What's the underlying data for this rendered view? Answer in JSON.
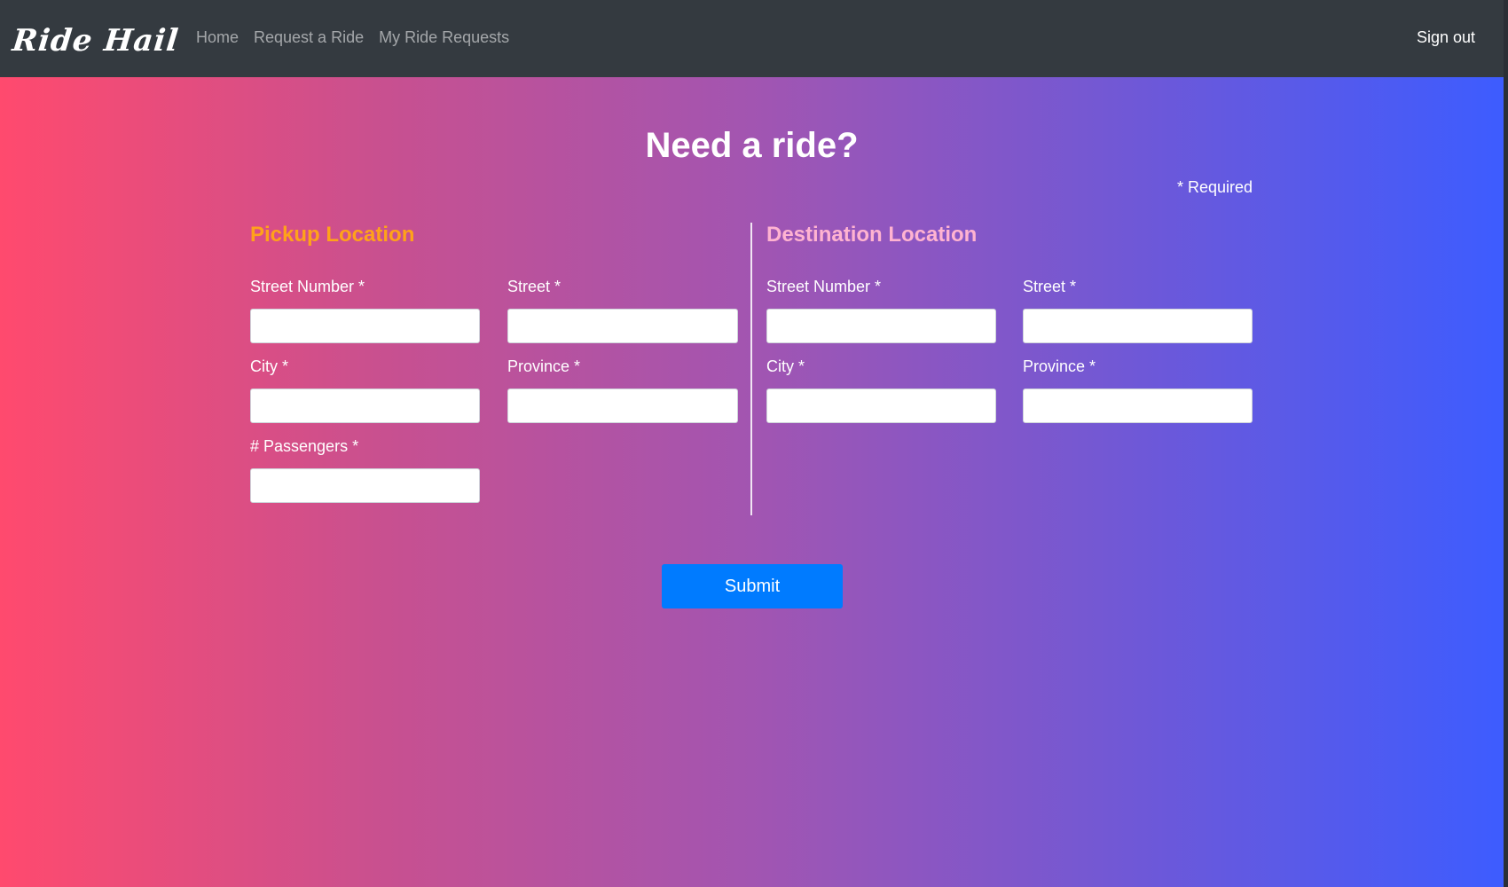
{
  "app": {
    "brand": "Ride Hail"
  },
  "nav": {
    "links": [
      "Home",
      "Request a Ride",
      "My Ride Requests"
    ],
    "signout": "Sign out"
  },
  "page": {
    "title": "Need a ride?",
    "required_note": "* Required"
  },
  "pickup": {
    "title": "Pickup Location",
    "street_number_label": "Street Number *",
    "street_label": "Street *",
    "city_label": "City *",
    "province_label": "Province *",
    "passengers_label": "# Passengers *",
    "street_number_value": "",
    "street_value": "",
    "city_value": "",
    "province_value": "",
    "passengers_value": ""
  },
  "destination": {
    "title": "Destination Location",
    "street_number_label": "Street Number *",
    "street_label": "Street *",
    "city_label": "City *",
    "province_label": "Province *",
    "street_number_value": "",
    "street_value": "",
    "city_value": "",
    "province_value": ""
  },
  "form": {
    "submit_label": "Submit"
  },
  "colors": {
    "navbar_bg": "#343a40",
    "pickup_title": "#ffa21a",
    "destination_title": "#ffb3d1",
    "submit_bg": "#007bff",
    "gradient_start": "#ff4a6e",
    "gradient_end": "#3d5cff"
  }
}
